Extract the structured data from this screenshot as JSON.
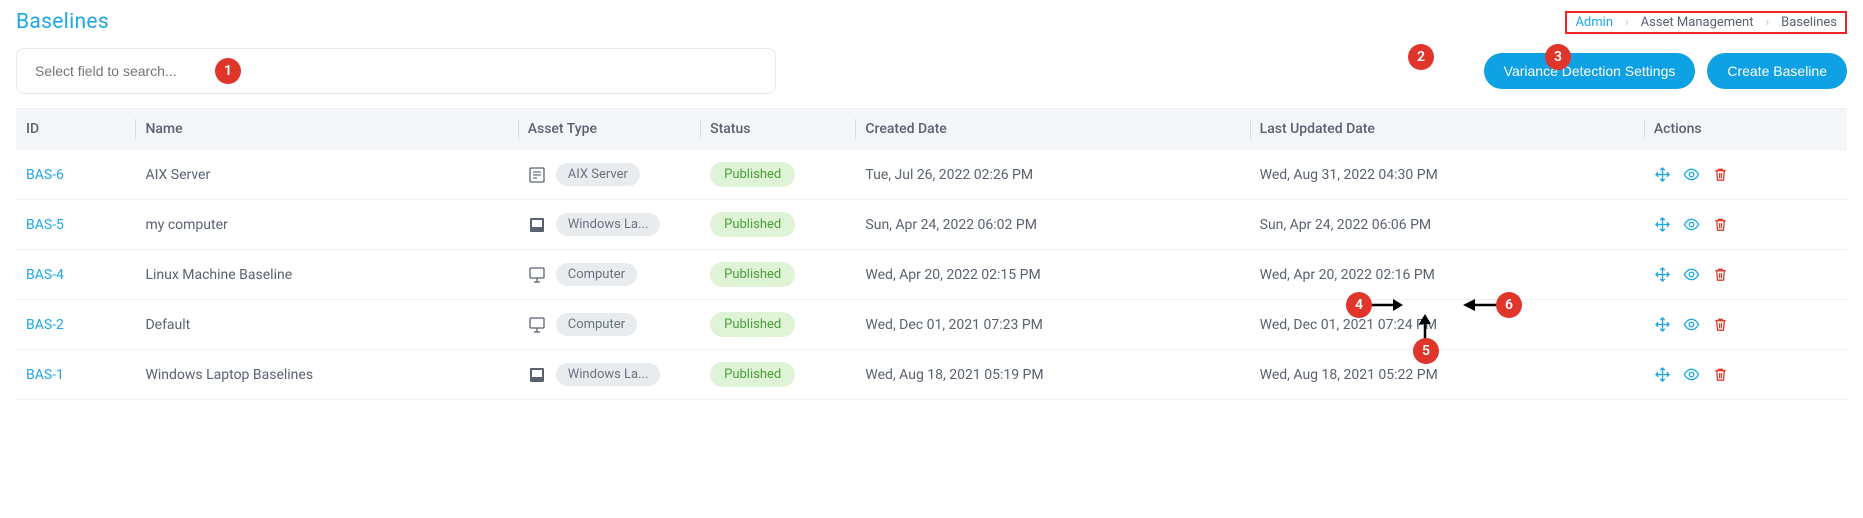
{
  "page_title": "Baselines",
  "breadcrumb": [
    {
      "label": "Admin",
      "link": true
    },
    {
      "label": "Asset Management",
      "link": false
    },
    {
      "label": "Baselines",
      "link": false
    }
  ],
  "search_placeholder": "Select field to search...",
  "buttons": {
    "variance": "Variance Detection Settings",
    "create": "Create Baseline"
  },
  "columns": {
    "id": "ID",
    "name": "Name",
    "asset_type": "Asset Type",
    "status": "Status",
    "created": "Created Date",
    "updated": "Last Updated Date",
    "actions": "Actions"
  },
  "rows": [
    {
      "id": "BAS-6",
      "name": "AIX Server",
      "asset_icon": "server",
      "asset_type": "AIX Server",
      "status": "Published",
      "created": "Tue, Jul 26, 2022 02:26 PM",
      "updated": "Wed, Aug 31, 2022 04:30 PM"
    },
    {
      "id": "BAS-5",
      "name": "my computer",
      "asset_icon": "laptop",
      "asset_type": "Windows La...",
      "status": "Published",
      "created": "Sun, Apr 24, 2022 06:02 PM",
      "updated": "Sun, Apr 24, 2022 06:06 PM"
    },
    {
      "id": "BAS-4",
      "name": "Linux Machine Baseline",
      "asset_icon": "computer",
      "asset_type": "Computer",
      "status": "Published",
      "created": "Wed, Apr 20, 2022 02:15 PM",
      "updated": "Wed, Apr 20, 2022 02:16 PM"
    },
    {
      "id": "BAS-2",
      "name": "Default",
      "asset_icon": "computer",
      "asset_type": "Computer",
      "status": "Published",
      "created": "Wed, Dec 01, 2021 07:23 PM",
      "updated": "Wed, Dec 01, 2021 07:24 PM"
    },
    {
      "id": "BAS-1",
      "name": "Windows Laptop Baselines",
      "asset_icon": "laptop",
      "asset_type": "Windows La...",
      "status": "Published",
      "created": "Wed, Aug 18, 2021 05:19 PM",
      "updated": "Wed, Aug 18, 2021 05:22 PM"
    }
  ],
  "callouts": {
    "c1": "1",
    "c2": "2",
    "c3": "3",
    "c4": "4",
    "c5": "5",
    "c6": "6"
  }
}
